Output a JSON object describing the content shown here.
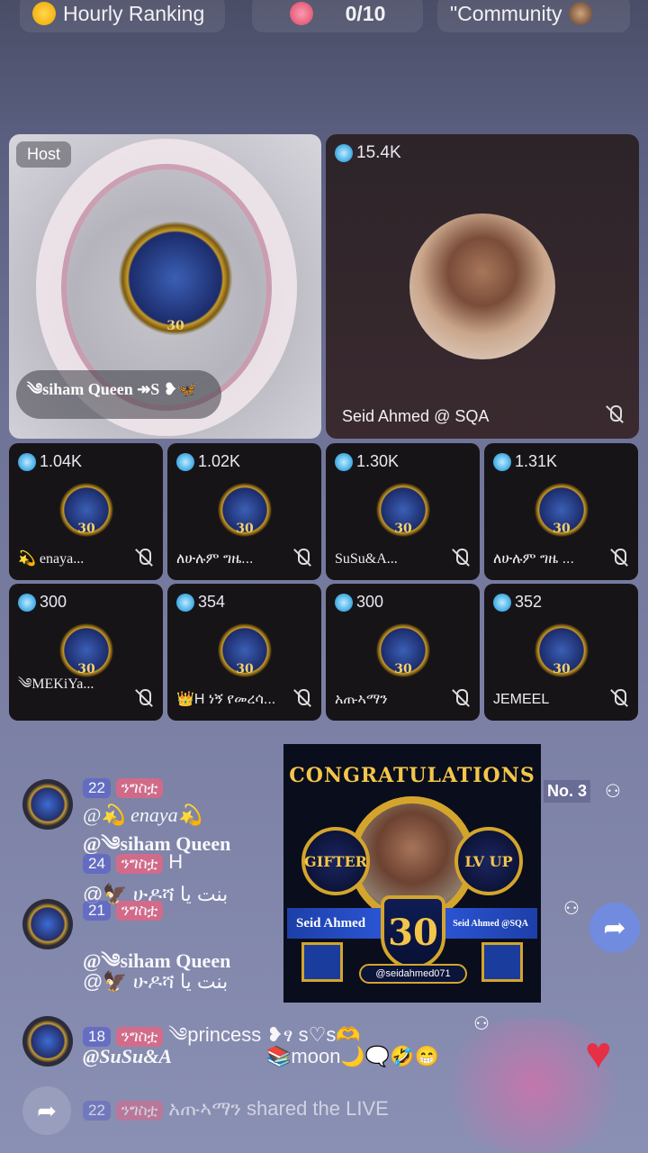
{
  "topbar": {
    "ranking_label": "Hourly Ranking",
    "counter": "0/10",
    "community_label": "\"Community"
  },
  "host": {
    "badge": "Host",
    "name": "༄siham Queen ↠S ❥🦋"
  },
  "main_guest": {
    "score": "15.4K",
    "name": "Seid Ahmed @ SQA"
  },
  "seats": [
    {
      "score": "1.04K",
      "name": "💫 enaya..."
    },
    {
      "score": "1.02K",
      "name": "ለሁሉም ግዜ..."
    },
    {
      "score": "1.30K",
      "name": "SuSu&A..."
    },
    {
      "score": "1.31K",
      "name": "ለሁሉም ግዜ ..."
    },
    {
      "score": "300",
      "name": "༄MEKiYa..."
    },
    {
      "score": "354",
      "name": "👑H ነኝ የመረሳ..."
    },
    {
      "score": "300",
      "name": "አጡኣማን"
    },
    {
      "score": "352",
      "name": "JEMEEL"
    }
  ],
  "poster": {
    "title": "CONGRATULATIONS",
    "left_badge": "GIFTER",
    "right_badge": "LV UP",
    "name_left": "Seid Ahmed",
    "name_right": "Seid Ahmed @SQA",
    "level": "30",
    "handle": "@seidahmed071"
  },
  "chat": {
    "rank_label": "No. 3",
    "rows": [
      {
        "level": "22",
        "tag": "ንግስቷ",
        "text": "@💫 enaya💫"
      },
      {
        "level": "",
        "tag": "",
        "text": "@༄siham Queen"
      },
      {
        "level": "24",
        "tag": "ንግስቷ",
        "text": "H"
      },
      {
        "level": "",
        "tag": "",
        "text": "@🦅 ሁዶሻ بنت يا"
      },
      {
        "level": "21",
        "tag": "ንግስቷ",
        "text": ""
      },
      {
        "level": "",
        "tag": "",
        "text": "@༄siham Queen"
      },
      {
        "level": "",
        "tag": "",
        "text": "@🦅 ሁዶሻ بنت يا"
      },
      {
        "level": "18",
        "tag": "ንግስቷ",
        "text": "༄princess ❥ፃ s♡s🫶"
      },
      {
        "level": "",
        "tag": "",
        "text": "@SuSu&A"
      },
      {
        "level": "",
        "tag": "",
        "text": "📚moon🌙🗨️🤣😁"
      },
      {
        "level": "22",
        "tag": "ንግስቷ",
        "text": "አጡኣማን shared the LIVE"
      }
    ]
  },
  "colors": {
    "accent_gold": "#d4a52c",
    "coin_blue": "#4fb3e8",
    "heart_red": "#e53045"
  }
}
